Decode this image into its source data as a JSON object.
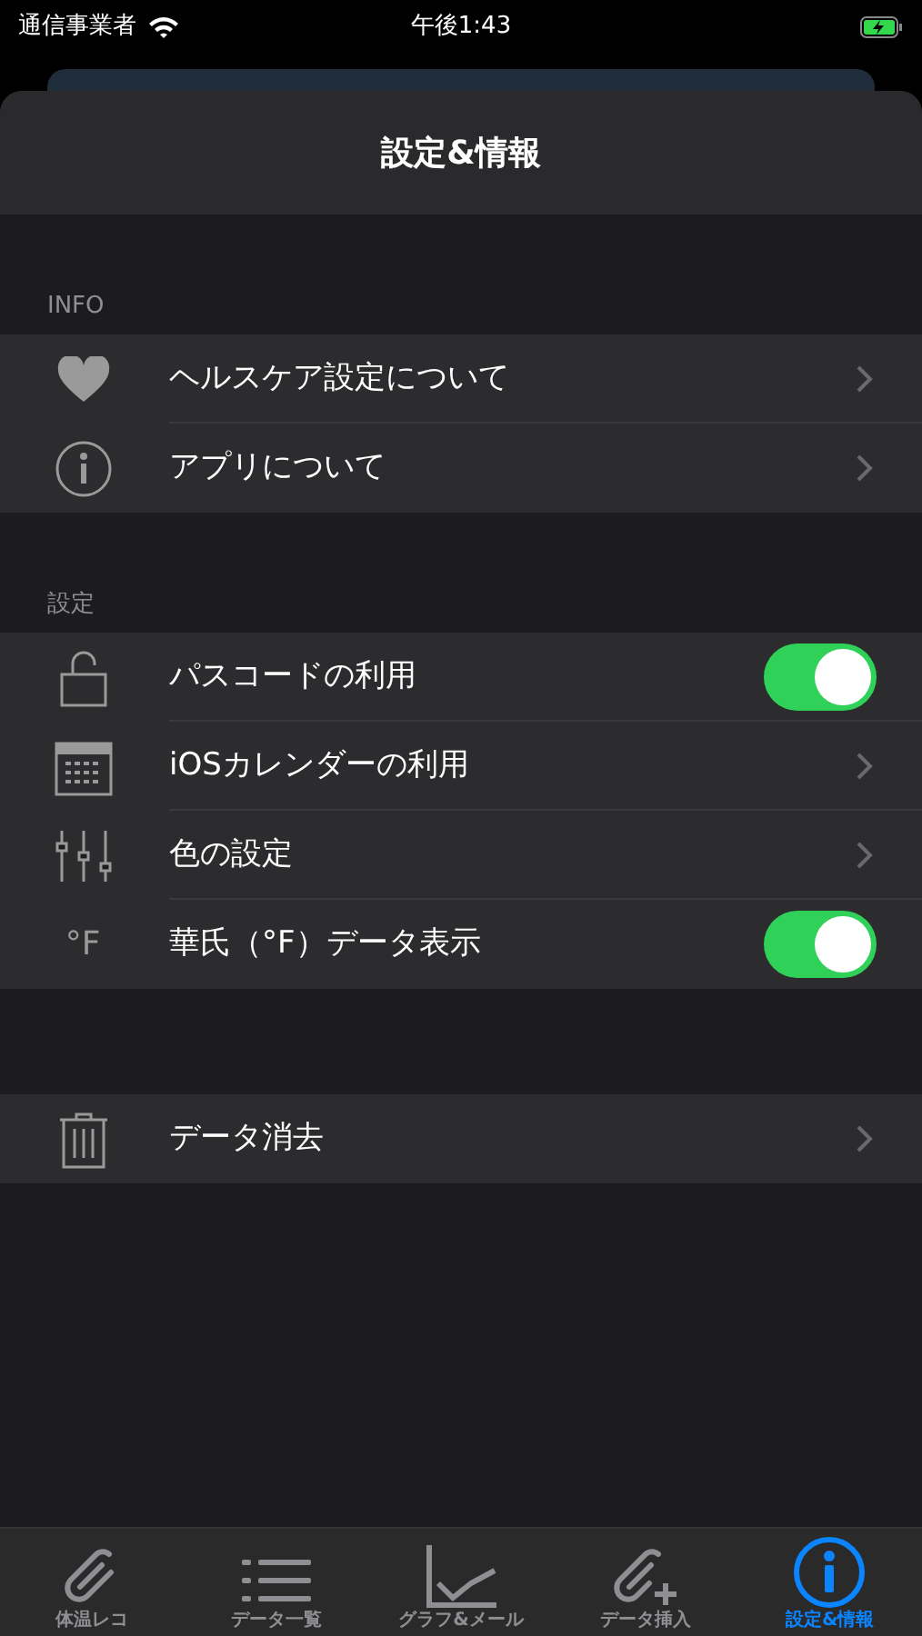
{
  "status_bar": {
    "carrier": "通信事業者",
    "time": "午後1:43"
  },
  "title": "設定&情報",
  "sections": [
    {
      "header": "INFO",
      "rows": [
        {
          "label": "ヘルスケア設定について",
          "kind": "chevron"
        },
        {
          "label": "アプリについて",
          "kind": "chevron"
        }
      ]
    },
    {
      "header": "設定",
      "rows": [
        {
          "label": "パスコードの利用",
          "kind": "toggle",
          "on": true
        },
        {
          "label": "iOSカレンダーの利用",
          "kind": "chevron"
        },
        {
          "label": "色の設定",
          "kind": "chevron"
        },
        {
          "label": "華氏（°F）データ表示",
          "kind": "toggle",
          "on": true,
          "icon_text": "°F"
        }
      ]
    },
    {
      "rows": [
        {
          "label": "データ消去",
          "kind": "chevron"
        }
      ]
    }
  ],
  "tabs": [
    {
      "label": "体温レコ",
      "selected": false
    },
    {
      "label": "データ一覧",
      "selected": false
    },
    {
      "label": "グラフ&メール",
      "selected": false
    },
    {
      "label": "データ挿入",
      "selected": false
    },
    {
      "label": "設定&情報",
      "selected": true
    }
  ]
}
